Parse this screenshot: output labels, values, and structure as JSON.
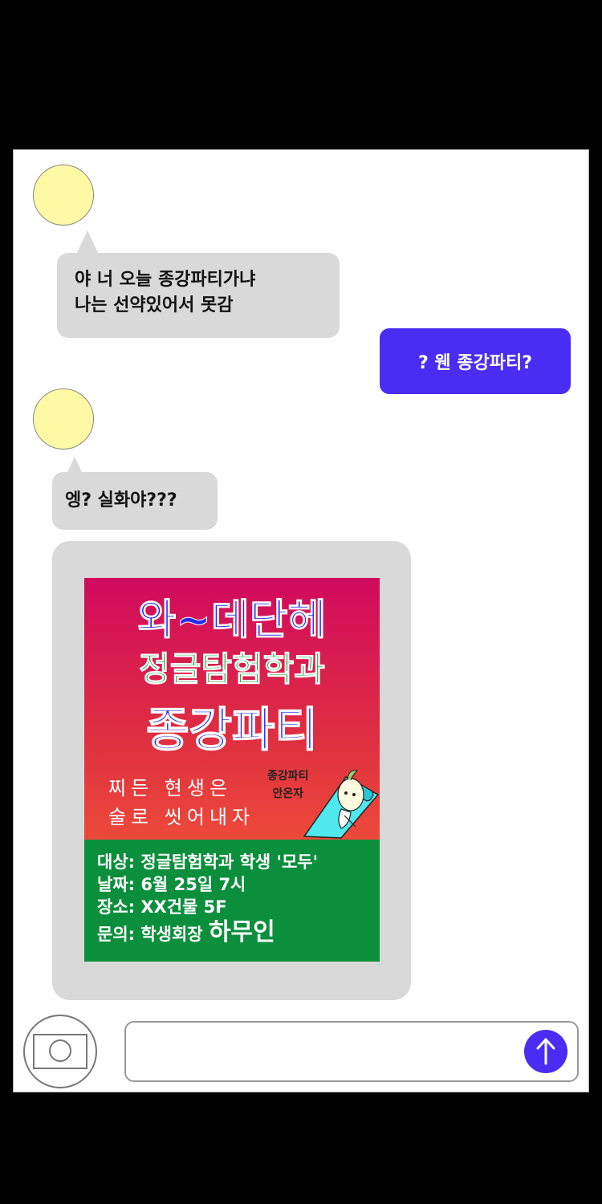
{
  "chat": {
    "messages": [
      {
        "side": "in",
        "lines": [
          "야 너 오늘 종강파티가냐",
          "나는 선약있어서 못감"
        ]
      },
      {
        "side": "out",
        "text": "? 웬 종강파티?"
      },
      {
        "side": "in",
        "text": "엥? 실화야???"
      }
    ],
    "poster": {
      "title_line1": "와~데단헤",
      "title_line2": "정글탐험학과",
      "title_line3": "종강파티",
      "slogan_line1": "찌든 현생은",
      "slogan_line2": "술로 씻어내자",
      "caption_line1": "종강파티",
      "caption_line2": "안온자",
      "info": {
        "target": "대상: 정글탐험학과 학생 '모두'",
        "date": "날짜: 6월 25일 7시",
        "place": "장소: XX건물 5F",
        "contact_label": "문의: 학생회장",
        "contact_name": "하무인"
      }
    }
  },
  "composer": {
    "input_value": "",
    "send_icon": "arrow-up-icon",
    "camera_icon": "camera-icon"
  },
  "colors": {
    "outgoing_bubble": "#4b2cf2",
    "incoming_bubble": "#d9d9d9",
    "avatar": "#fff9a6",
    "poster_info_band": "#0c8f3c"
  }
}
